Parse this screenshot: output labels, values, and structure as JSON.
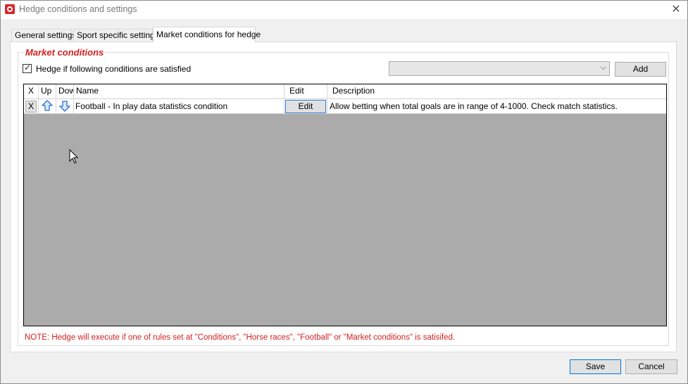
{
  "window": {
    "title": "Hedge conditions and settings",
    "close_glyph": "✕"
  },
  "tabs": [
    {
      "label": "General settings",
      "active": false
    },
    {
      "label": "Sport specific settings",
      "active": false
    },
    {
      "label": "Market conditions for hedge",
      "active": true
    }
  ],
  "market_conditions": {
    "group_title": "Market conditions",
    "checkbox_label": "Hedge if following conditions are satisfied",
    "checkbox_checked": true,
    "dropdown_value": "",
    "add_label": "Add"
  },
  "grid": {
    "columns": [
      "X",
      "Up",
      "Dow",
      "Name",
      "Edit",
      "Description"
    ],
    "rows": [
      {
        "x_label": "X",
        "up_icon": "arrow-up-icon",
        "down_icon": "arrow-down-icon",
        "name": "Football - In play data statistics condition",
        "edit_label": "Edit",
        "description": "Allow betting when total goals are in range of 4-1000. Check match statistics."
      }
    ]
  },
  "note": "NOTE: Hedge will execute if one of rules set at \"Conditions\", \"Horse races\", \"Football\" or \"Market conditions\" is satisifed.",
  "footer": {
    "save_label": "Save",
    "cancel_label": "Cancel"
  },
  "colors": {
    "accent_red": "#d42020",
    "focus_blue": "#0078d7",
    "grid_background": "#ababab"
  }
}
